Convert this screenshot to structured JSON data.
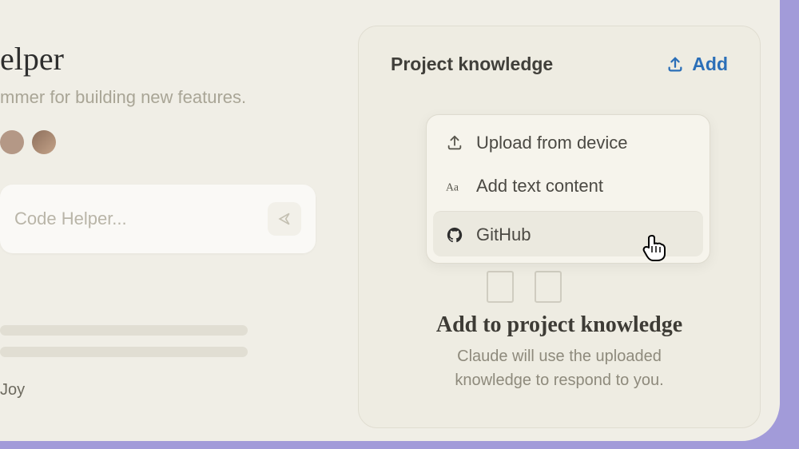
{
  "left": {
    "title_fragment": "elper",
    "subtitle_fragment": "mmer for building new features.",
    "input_placeholder_fragment": "Code Helper...",
    "footer_text_fragment": " Joy"
  },
  "panel": {
    "title": "Project knowledge",
    "add_label": "Add"
  },
  "dropdown": {
    "items": [
      {
        "icon": "upload-icon",
        "label": "Upload from device"
      },
      {
        "icon": "text-icon",
        "label": "Add text content"
      },
      {
        "icon": "github-icon",
        "label": "GitHub"
      }
    ]
  },
  "knowledge": {
    "heading": "Add to project knowledge",
    "description_line1": "Claude will use the uploaded",
    "description_line2": "knowledge  to respond to you."
  },
  "colors": {
    "accent": "#2b6fb8",
    "bg": "#f0eee6",
    "outer": "#a29bd9"
  }
}
